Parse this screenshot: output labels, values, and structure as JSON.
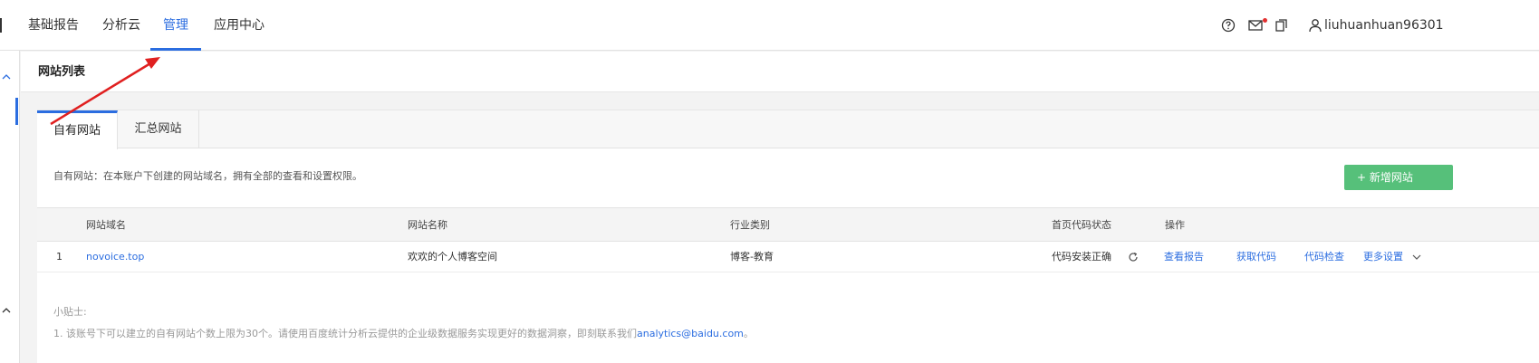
{
  "nav": {
    "items": [
      {
        "label": "基础报告",
        "active": false
      },
      {
        "label": "分析云",
        "active": false
      },
      {
        "label": "管理",
        "active": true
      },
      {
        "label": "应用中心",
        "active": false
      }
    ],
    "username": "liuhuanhuan96301"
  },
  "page": {
    "title": "网站列表"
  },
  "tabs": [
    {
      "label": "自有网站",
      "active": true
    },
    {
      "label": "汇总网站",
      "active": false
    }
  ],
  "description": "自有网站：在本账户下创建的网站域名，拥有全部的查看和设置权限。",
  "add_button": {
    "label": "+ 新增网站"
  },
  "table": {
    "headers": [
      "网站域名",
      "网站名称",
      "行业类别",
      "首页代码状态",
      "操作"
    ],
    "rows": [
      {
        "index": "1",
        "domain": "novoice.top",
        "name": "欢欢的个人博客空间",
        "industry": "博客-教育",
        "code_status": "代码安装正确",
        "actions": [
          "查看报告",
          "获取代码",
          "代码检查",
          "更多设置"
        ]
      }
    ]
  },
  "tips": {
    "title": "小贴士:",
    "line1_prefix": "1. 该账号下可以建立的自有网站个数上限为30个。请使用百度统计分析云提供的企业级数据服务实现更好的数据洞察，即刻联系我们",
    "line1_email": "analytics@baidu.com",
    "line1_suffix": "。"
  },
  "colors": {
    "accent": "#2b6de0",
    "add_button": "#56c07a",
    "annotation_arrow": "#e02020",
    "notification_dot": "#e23030"
  }
}
